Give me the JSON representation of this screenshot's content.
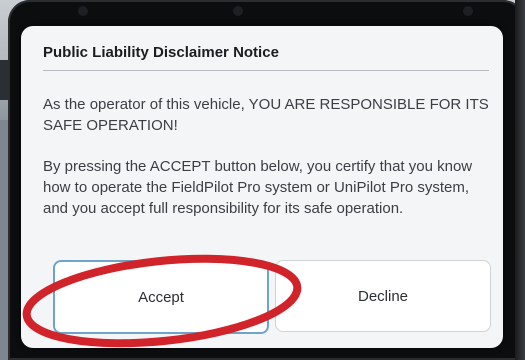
{
  "dialog": {
    "title": "Public Liability Disclaimer Notice",
    "paragraph1": "As the operator of this vehicle, YOU ARE RESPONSIBLE FOR ITS SAFE OPERATION!",
    "paragraph2": "By pressing the ACCEPT button below, you certify that you know how to operate the FieldPilot Pro system or UniPilot Pro system, and you accept full responsibility for its safe operation.",
    "accept_label": "Accept",
    "decline_label": "Decline"
  },
  "colors": {
    "highlight": "#d0232a",
    "accept_border": "#6ea4c8",
    "dialog_bg": "#f4f5f6"
  }
}
